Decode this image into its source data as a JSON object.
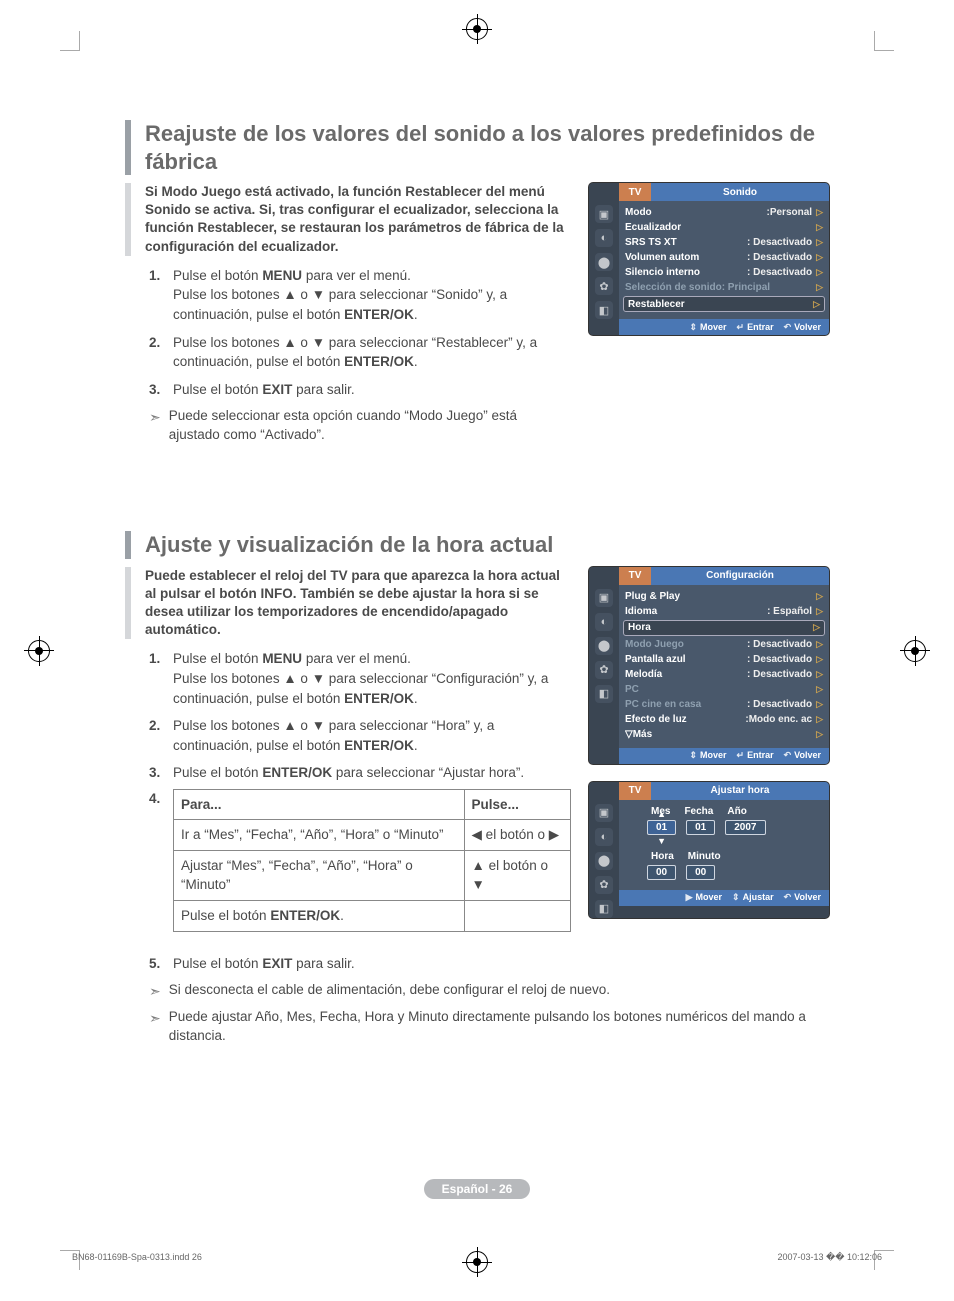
{
  "sections": [
    {
      "title": "Reajuste de los valores del sonido a los valores predefinidos de fábrica",
      "intro": "Si Modo Juego está activado, la función Restablecer del menú Sonido se activa. Si, tras configurar el ecualizador, selecciona la función Restablecer, se restauran los parámetros de fábrica de la configuración del ecualizador.",
      "steps": [
        {
          "n": "1.",
          "html": "Pulse el botón <b>MENU</b> para ver el menú.<br>Pulse los botones ▲ o ▼ para seleccionar “Sonido” y, a continuación, pulse el botón <b>ENTER/OK</b>."
        },
        {
          "n": "2.",
          "html": "Pulse los botones ▲ o ▼ para seleccionar “Restablecer” y, a continuación, pulse el botón <b>ENTER/OK</b>."
        },
        {
          "n": "3.",
          "html": "Pulse el botón <b>EXIT</b> para salir."
        }
      ],
      "notes": [
        "Puede seleccionar esta opción cuando “Modo Juego” está ajustado como “Activado”."
      ]
    },
    {
      "title": "Ajuste y visualización de la hora actual",
      "intro": "Puede establecer el reloj del TV para que aparezca la hora actual al pulsar el botón INFO. También se debe ajustar la hora si se desea utilizar los temporizadores de encendido/apagado automático.",
      "steps": [
        {
          "n": "1.",
          "html": "Pulse el botón <b>MENU</b> para ver el menú.<br>Pulse los botones ▲ o ▼ para seleccionar “Configuración” y, a continuación, pulse el botón <b>ENTER/OK</b>."
        },
        {
          "n": "2.",
          "html": "Pulse los botones ▲ o ▼ para seleccionar “Hora” y, a continuación, pulse el botón <b>ENTER/OK</b>."
        },
        {
          "n": "3.",
          "html": "Pulse el botón <b>ENTER/OK</b> para seleccionar “Ajustar hora”."
        }
      ],
      "table": {
        "head": [
          "Para...",
          "Pulse..."
        ],
        "rows": [
          [
            "Ir a “Mes”, “Fecha”, “Año”, “Hora” o “Minuto”",
            "◀ el botón  o ▶"
          ],
          [
            "Ajustar “Mes”, “Fecha”, “Año”, “Hora” o “Minuto”",
            "▲ el botón  o ▼"
          ],
          [
            "Pulse el botón <b>ENTER/OK</b>.",
            ""
          ]
        ]
      },
      "step4num": "4.",
      "step5": {
        "n": "5.",
        "html": "Pulse el botón <b>EXIT</b> para salir."
      },
      "notes": [
        "Si desconecta el cable de alimentación, debe configurar el reloj de nuevo.",
        "Puede ajustar Año, Mes, Fecha, Hora y Minuto directamente pulsando los botones numéricos del mando a distancia."
      ]
    }
  ],
  "osd1": {
    "tv": "TV",
    "title": "Sonido",
    "rows": [
      {
        "label": "Modo",
        "value": ":Personal"
      },
      {
        "label": "Ecualizador",
        "value": ""
      },
      {
        "label": "SRS TS XT",
        "value": ": Desactivado"
      },
      {
        "label": "Volumen autom",
        "value": ": Desactivado"
      },
      {
        "label": "Silencio interno",
        "value": ": Desactivado"
      },
      {
        "label": "Selección de sonido: Principal",
        "value": "",
        "dim": true
      },
      {
        "label": "Restablecer",
        "value": "",
        "sel": true
      }
    ],
    "footer": {
      "move": "Mover",
      "enter": "Entrar",
      "back": "Volver"
    }
  },
  "osd2": {
    "tv": "TV",
    "title": "Configuración",
    "rows": [
      {
        "label": "Plug & Play",
        "value": ""
      },
      {
        "label": "Idioma",
        "value": ": Español"
      },
      {
        "label": "Hora",
        "value": "",
        "sel": true
      },
      {
        "label": "Modo Juego",
        "value": ": Desactivado",
        "dim": true
      },
      {
        "label": "Pantalla azul",
        "value": ": Desactivado"
      },
      {
        "label": "Melodía",
        "value": ": Desactivado"
      },
      {
        "label": "PC",
        "value": "",
        "dim": true
      },
      {
        "label": "PC cine en casa",
        "value": ": Desactivado",
        "dim": true
      },
      {
        "label": "Efecto de luz",
        "value": ":Modo enc. ac"
      },
      {
        "label": "▽Más",
        "value": ""
      }
    ],
    "footer": {
      "move": "Mover",
      "enter": "Entrar",
      "back": "Volver"
    }
  },
  "osd3": {
    "tv": "TV",
    "title": "Ajustar hora",
    "labels1": [
      "Mes",
      "Fecha",
      "Año"
    ],
    "vals1": [
      "01",
      "01",
      "2007"
    ],
    "labels2": [
      "Hora",
      "Minuto"
    ],
    "vals2": [
      "00",
      "00"
    ],
    "footer": {
      "move": "Mover",
      "adjust": "Ajustar",
      "back": "Volver"
    }
  },
  "page_label": "Español - 26",
  "print": {
    "file": "BN68-01169B-Spa-0313.indd   26",
    "ts": "2007-03-13   �� 10:12:06"
  }
}
